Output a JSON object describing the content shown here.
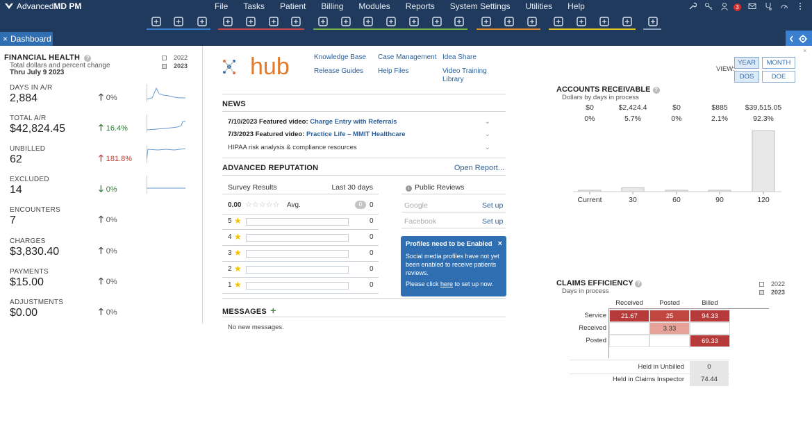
{
  "app": {
    "title_plain": "Advanced",
    "title_bold": "MD PM"
  },
  "menu": [
    "File",
    "Tasks",
    "Patient",
    "Billing",
    "Modules",
    "Reports",
    "System Settings",
    "Utilities",
    "Help"
  ],
  "notifications": {
    "count": "3"
  },
  "toolbar_groups": [
    {
      "color": "#3d7fd1",
      "icons": [
        "patient-icon",
        "calendar-card-icon",
        "user-search-icon"
      ]
    },
    {
      "color": "#d14a4a",
      "icons": [
        "scheduler-icon",
        "alarm-icon",
        "user-edit-icon",
        "phone-icon"
      ]
    },
    {
      "color": "#6fb24a",
      "icons": [
        "calculator-icon",
        "list-icon",
        "upload-icon",
        "download-icon",
        "dollar-file-icon",
        "clock-icon",
        "file-search-icon"
      ]
    },
    {
      "color": "#e08a2a",
      "icons": [
        "document-edit-icon",
        "document-search-icon",
        "satellite-icon"
      ]
    },
    {
      "color": "#e3c22a",
      "icons": [
        "bar-chart-icon",
        "chart-search-icon",
        "chart-line-icon",
        "chart-gear-icon"
      ]
    },
    {
      "color": "#8aa0b8",
      "icons": [
        "monitor-icon"
      ]
    }
  ],
  "tab": {
    "label": "Dashboard",
    "close": "×"
  },
  "financial_health": {
    "title": "FINANCIAL HEALTH",
    "subtitle": "Total dollars and percent change",
    "date": "Thru July 9 2023",
    "years": [
      "2022",
      "2023"
    ],
    "metrics": [
      {
        "label": "DAYS IN A/R",
        "value": "2,884",
        "change": "0%",
        "dir": "up",
        "color": "#555555"
      },
      {
        "label": "TOTAL A/R",
        "value": "$42,824.45",
        "change": "16.4%",
        "dir": "up",
        "color": "#2e7d32"
      },
      {
        "label": "UNBILLED",
        "value": "62",
        "change": "181.8%",
        "dir": "up",
        "color": "#c0392b"
      },
      {
        "label": "EXCLUDED",
        "value": "14",
        "change": "0%",
        "dir": "down",
        "color": "#2e7d32"
      },
      {
        "label": "ENCOUNTERS",
        "value": "7",
        "change": "0%",
        "dir": "up",
        "color": "#555555"
      },
      {
        "label": "CHARGES",
        "value": "$3,830.40",
        "change": "0%",
        "dir": "up",
        "color": "#555555"
      },
      {
        "label": "PAYMENTS",
        "value": "$15.00",
        "change": "0%",
        "dir": "up",
        "color": "#555555"
      },
      {
        "label": "ADJUSTMENTS",
        "value": "$0.00",
        "change": "0%",
        "dir": "up",
        "color": "#555555"
      }
    ]
  },
  "hub": {
    "logo_text": "hub",
    "links": [
      "Knowledge Base",
      "Case Management",
      "Idea Share",
      "Release Guides",
      "Help Files",
      "Video Training",
      "Library"
    ]
  },
  "news": {
    "title": "NEWS",
    "items": [
      {
        "date": "7/10/2023 Featured video:",
        "link": "Charge Entry with Referrals"
      },
      {
        "date": "7/3/2023 Featured video:",
        "link": "Practice Life – MMIT Healthcare"
      },
      {
        "date": "",
        "link": "",
        "text": "HIPAA risk analysis & compliance resources"
      }
    ]
  },
  "reputation": {
    "title": "ADVANCED REPUTATION",
    "open_report": "Open Report...",
    "survey_label": "Survey Results",
    "range": "Last 30 days",
    "avg_value": "0.00",
    "avg_label": "Avg.",
    "avg_count": "0",
    "avg_badge": "0",
    "rows": [
      {
        "stars": "5",
        "count": "0"
      },
      {
        "stars": "4",
        "count": "0"
      },
      {
        "stars": "3",
        "count": "0"
      },
      {
        "stars": "2",
        "count": "0"
      },
      {
        "stars": "1",
        "count": "0"
      }
    ],
    "public_reviews": "Public Reviews",
    "sources": [
      {
        "name": "Google",
        "action": "Set up"
      },
      {
        "name": "Facebook",
        "action": "Set up"
      }
    ],
    "toast": {
      "title": "Profiles need to be Enabled",
      "body": "Social media profiles have not yet been enabled to receive patients reviews.",
      "cta_pre": "Please click ",
      "cta_link": "here",
      "cta_post": " to set up now."
    }
  },
  "messages": {
    "title": "MESSAGES",
    "add": "+",
    "empty": "No new messages."
  },
  "view": {
    "label": "VIEW:",
    "buttons": [
      "YEAR",
      "MONTH",
      "DOS",
      "DOE"
    ],
    "active": [
      "YEAR",
      "DOS"
    ]
  },
  "accounts_receivable": {
    "title": "ACCOUNTS RECEIVABLE",
    "subtitle": "Dollars by days in process",
    "bar_color": "#e8e8e8"
  },
  "chart_data": {
    "type": "bar",
    "categories": [
      "Current",
      "30",
      "60",
      "90",
      "120"
    ],
    "values": [
      0,
      2424.4,
      0,
      885,
      39515.05
    ],
    "value_labels": [
      "$0",
      "$2,424.4",
      "$0",
      "$885",
      "$39,515.05"
    ],
    "percent_labels": [
      "0%",
      "5.7%",
      "0%",
      "2.1%",
      "92.3%"
    ],
    "percents": [
      0,
      5.7,
      0,
      2.1,
      92.3
    ],
    "title": "ACCOUNTS RECEIVABLE",
    "subtitle": "Dollars by days in process",
    "ylim": [
      0,
      100
    ]
  },
  "claims_efficiency": {
    "title": "CLAIMS EFFICIENCY",
    "subtitle": "Days in process",
    "years": [
      "2022",
      "2023"
    ],
    "col_headers": [
      "Received",
      "Posted",
      "Billed"
    ],
    "rows": [
      {
        "label": "Service",
        "cells": [
          "21.67",
          "25",
          "94.33"
        ]
      },
      {
        "label": "Received",
        "cells": [
          "",
          "3.33",
          ""
        ]
      },
      {
        "label": "Posted",
        "cells": [
          "",
          "",
          "69.33"
        ]
      }
    ],
    "held_unbilled_label": "Held in Unbilled",
    "held_unbilled_value": "0",
    "held_inspector_label": "Held in Claims Inspector",
    "held_inspector_value": "74.44"
  }
}
